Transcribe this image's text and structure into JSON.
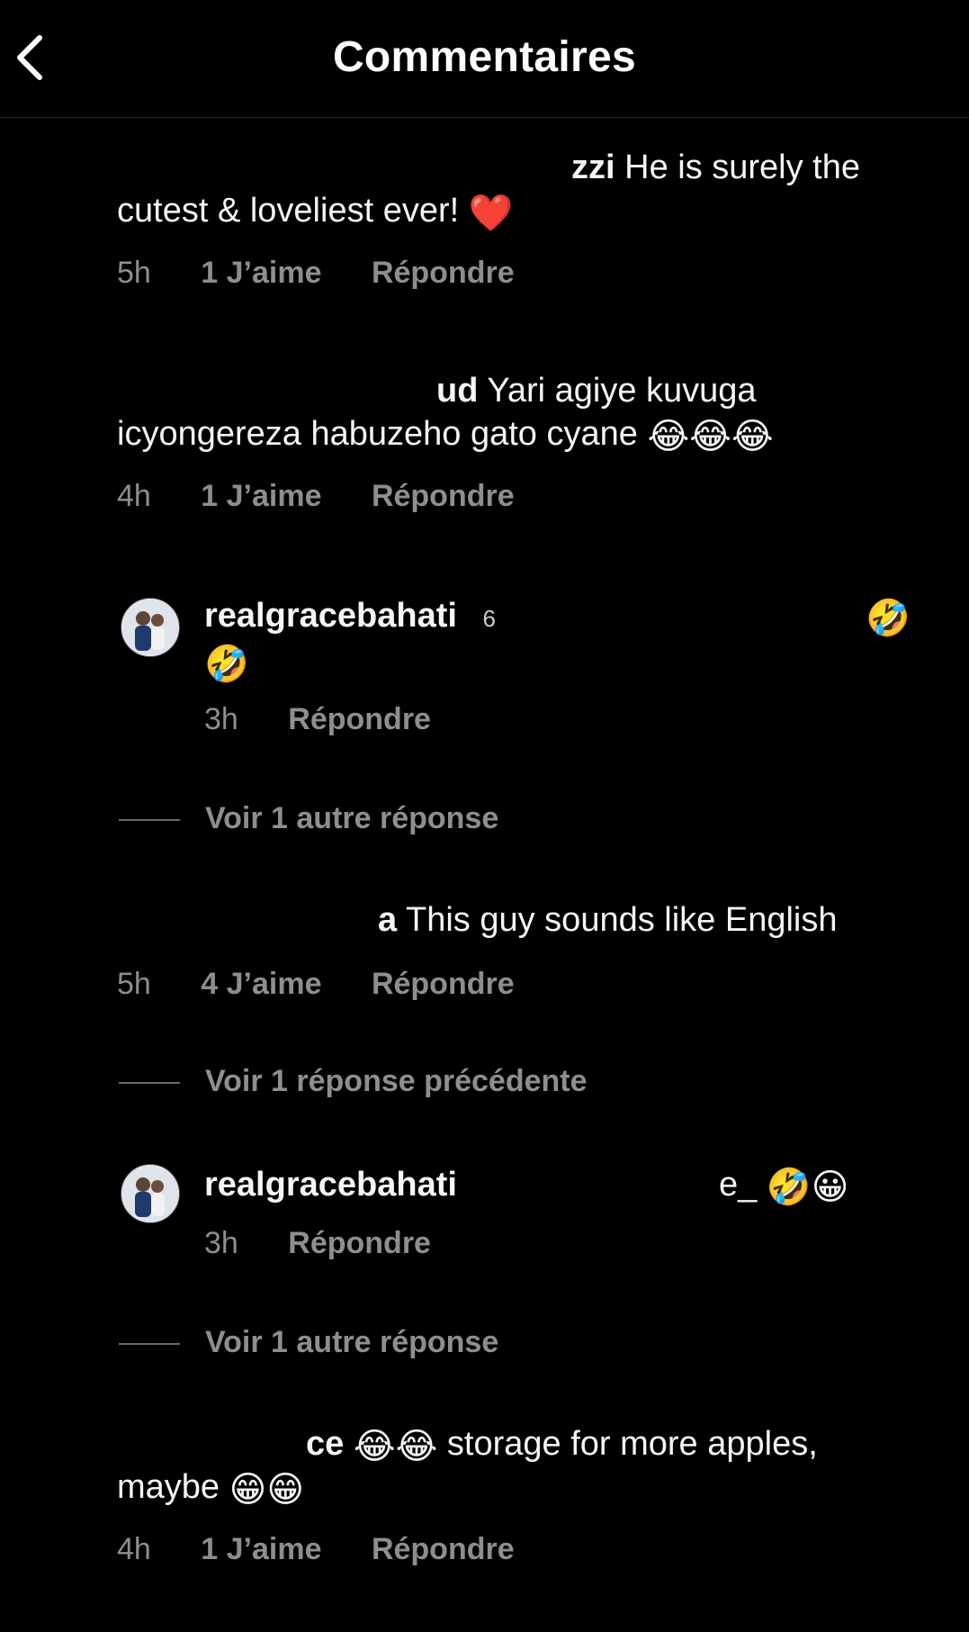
{
  "header": {
    "title": "Commentaires",
    "back_icon": "chevron-left-icon"
  },
  "comments": [
    {
      "username_visible": "zzi",
      "text": "He is surely the cutest & loveliest ever!",
      "emojis": "❤️",
      "time": "5h",
      "likes": "1 J’aime",
      "reply": "Répondre"
    },
    {
      "username_visible": "ud",
      "text": "Yari agiye kuvuga icyongereza habuzeho gato cyane",
      "emojis": "😂😂😂",
      "time": "4h",
      "likes": "1 J’aime",
      "reply": "Répondre"
    },
    {
      "username": "realgracebahati",
      "text_visible": "6",
      "emojis": "🤣",
      "emojis2": "🤣",
      "time": "3h",
      "reply": "Répondre",
      "avatar_icon": "profile-photo"
    },
    {
      "thread_link": "Voir 1 autre réponse"
    },
    {
      "username_visible": "a",
      "text": "This guy sounds like English",
      "time": "5h",
      "likes": "4 J’aime",
      "reply": "Répondre"
    },
    {
      "thread_link": "Voir 1 réponse précédente"
    },
    {
      "username": "realgracebahati",
      "text_visible": "e_",
      "emojis": "🤣😀",
      "time": "3h",
      "reply": "Répondre",
      "avatar_icon": "profile-photo"
    },
    {
      "thread_link": "Voir 1 autre réponse"
    },
    {
      "username_visible": "ce",
      "emojis_lead": "😂😂",
      "text": "storage for more apples,",
      "text2": "maybe",
      "emojis": "😁😁",
      "time": "4h",
      "likes": "1 J’aime",
      "reply": "Répondre"
    }
  ],
  "colors": {
    "background": "#000000",
    "text": "#f5f5f5",
    "meta": "#8e8e8e"
  }
}
